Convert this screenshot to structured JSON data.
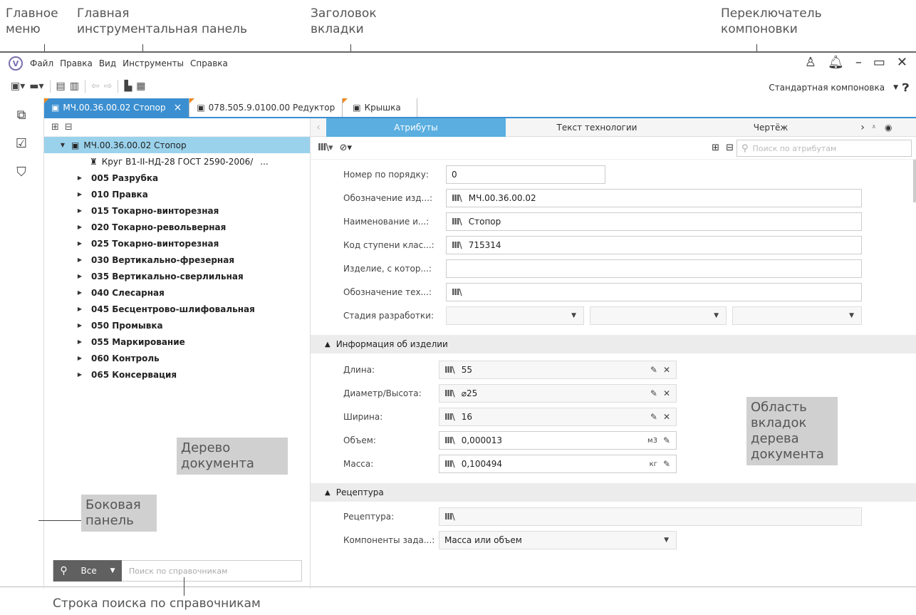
{
  "annotations": {
    "main_menu": "Главное\nменю",
    "main_toolbar": "Главная\nинструментальная панель",
    "tab_header": "Заголовок\nвкладки",
    "layout_switcher": "Переключатель\nкомпоновки",
    "doc_tree": "Дерево\nдокумента",
    "side_panel": "Боковая\nпанель",
    "tree_tabs_area": "Область\nвкладок\nдерева\nдокумента",
    "ref_search": "Строка поиска по справочникам"
  },
  "menu": [
    "Файл",
    "Правка",
    "Вид",
    "Инструменты",
    "Справка"
  ],
  "layout": {
    "label": "Стандартная компоновка"
  },
  "tabs": [
    {
      "label": "МЧ.00.36.00.02 Стопор",
      "close": "×",
      "active": true
    },
    {
      "label": "078.505.9.0100.00 Редуктор",
      "active": false
    },
    {
      "label": "Крышка",
      "active": false
    }
  ],
  "tree": {
    "root": "МЧ.00.36.00.02 Стопор",
    "material": "Круг В1-II-НД-28 ГОСТ 2590-2006/",
    "material_more": "...",
    "operations": [
      "005 Разрубка",
      "010 Правка",
      "015 Токарно-винторезная",
      "020 Токарно-револьверная",
      "025 Токарно-винторезная",
      "030 Вертикально-фрезерная",
      "035 Вертикально-сверлильная",
      "040 Слесарная",
      "045 Бесцентрово-шлифовальная",
      "050 Промывка",
      "055 Маркирование",
      "060 Контроль",
      "065 Консервация"
    ]
  },
  "search": {
    "scope": "Все",
    "placeholder": "Поиск по справочникам"
  },
  "subtabs": [
    "Атрибуты",
    "Текст технологии",
    "Чертёж"
  ],
  "attr_search_placeholder": "Поиск по атрибутам",
  "fields": {
    "order_num": {
      "label": "Номер по порядку:",
      "value": "0"
    },
    "designation": {
      "label": "Обозначение изд...:",
      "value": "МЧ.00.36.00.02"
    },
    "name": {
      "label": "Наименование и...:",
      "value": "Стопор"
    },
    "class_code": {
      "label": "Код ступени клас...:",
      "value": "715314"
    },
    "product_from": {
      "label": "Изделие, с котор...:",
      "value": ""
    },
    "tech_designation": {
      "label": "Обозначение тех...:",
      "value": ""
    },
    "dev_stage": {
      "label": "Стадия разработки:",
      "value": ""
    }
  },
  "product_info": {
    "title": "Информация об изделии",
    "length": {
      "label": "Длина:",
      "value": "55"
    },
    "diameter": {
      "label": "Диаметр/Высота:",
      "value": "⌀25"
    },
    "width": {
      "label": "Ширина:",
      "value": "16"
    },
    "volume": {
      "label": "Объем:",
      "value": "0,000013",
      "unit": "м3"
    },
    "mass": {
      "label": "Масса:",
      "value": "0,100494",
      "unit": "кг"
    }
  },
  "recipe": {
    "title": "Рецептура",
    "recipe_field": {
      "label": "Рецептура:"
    },
    "components": {
      "label": "Компоненты зада...:",
      "value": "Масса или объем"
    }
  },
  "colors": {
    "accent": "#3b8fd0",
    "tree_selection": "#9ad2ec",
    "tab_corner": "#f08a1e"
  }
}
